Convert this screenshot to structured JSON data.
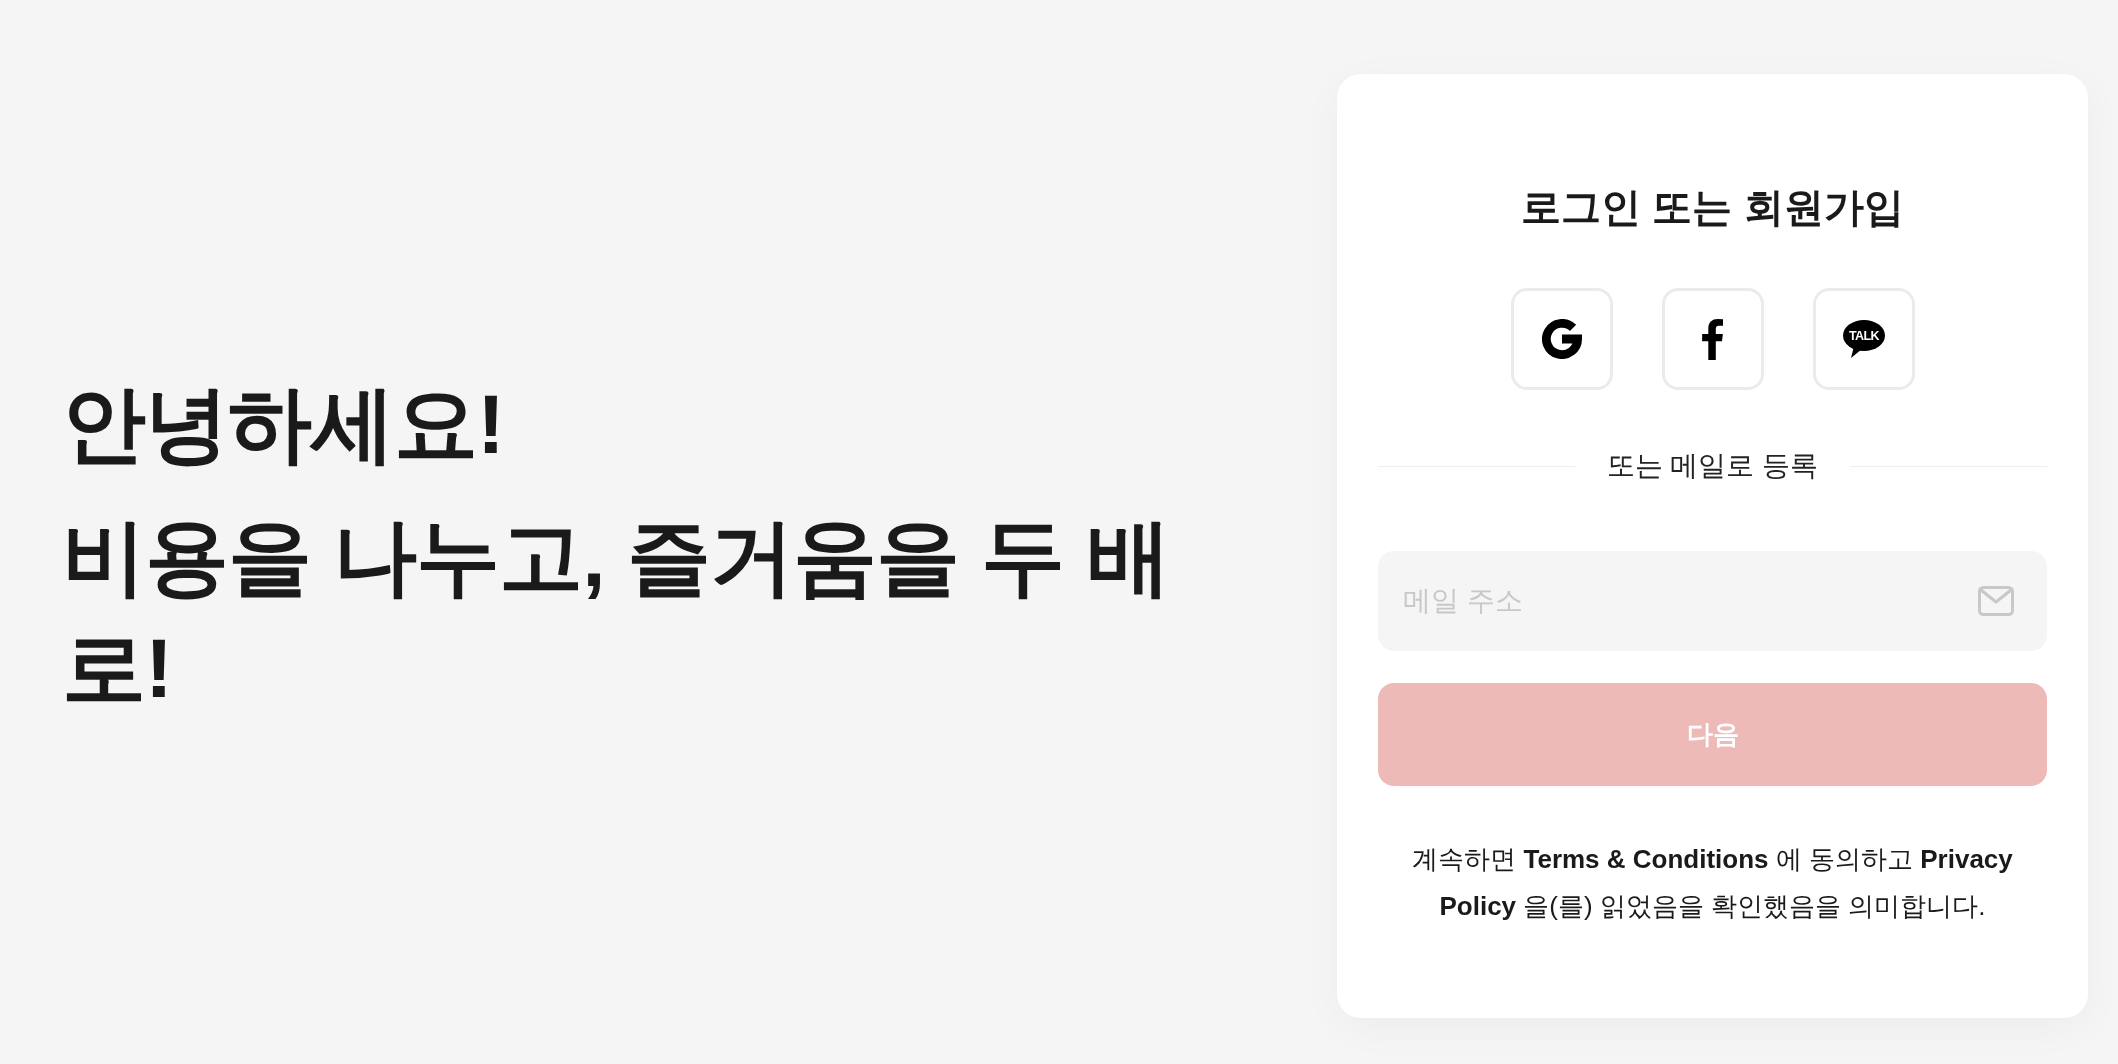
{
  "hero": {
    "greeting": "안녕하세요!",
    "tagline": "비용을 나누고, 즐거움을 두 배로!"
  },
  "login_card": {
    "title": "로그인 또는 회원가입",
    "social_buttons": [
      {
        "kind": "google"
      },
      {
        "kind": "facebook"
      },
      {
        "kind": "kakao",
        "text": "TALK"
      }
    ],
    "divider_label": "또는 메일로 등록",
    "email_field": {
      "placeholder": "메일 주소"
    },
    "next_button": {
      "label": "다음",
      "disabled": true
    },
    "terms": "계속하면 **Terms & Conditions** 에 동의하고 **Privacy Policy** 을(를) 읽었음을 확인했음을 의미합니다."
  }
}
